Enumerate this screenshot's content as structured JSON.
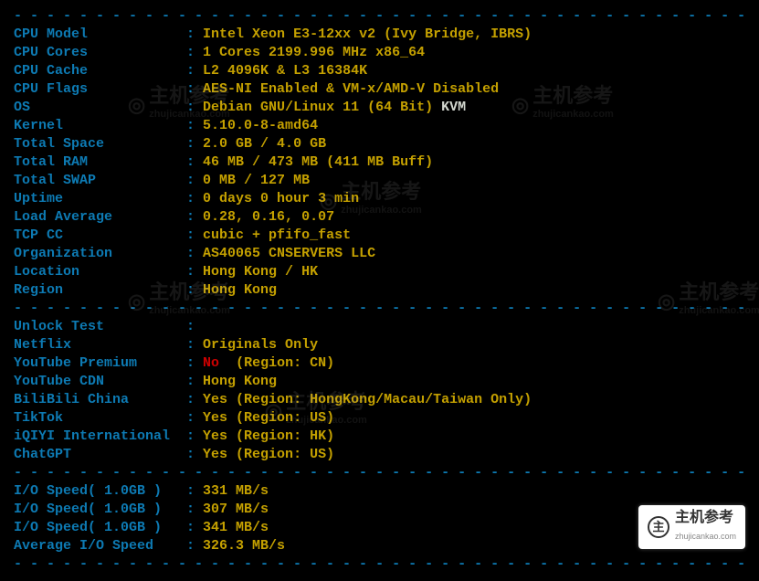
{
  "divider": "- - - - - - - - - - - - - - - - - - - - - - - - - - - - - - - - - - - - - - - - - - - - -",
  "rows": [
    {
      "label": "CPU Model",
      "value": "Intel Xeon E3-12xx v2 (Ivy Bridge, IBRS)"
    },
    {
      "label": "CPU Cores",
      "value": "1 Cores 2199.996 MHz x86_64"
    },
    {
      "label": "CPU Cache",
      "value": "L2 4096K & L3 16384K"
    },
    {
      "label": "CPU Flags",
      "value": "AES-NI Enabled & VM-x/AMD-V Disabled"
    },
    {
      "label": "OS",
      "value": "Debian GNU/Linux 11 (64 Bit)",
      "extra": " KVM",
      "extra_class": "white"
    },
    {
      "label": "Kernel",
      "value": "5.10.0-8-amd64"
    },
    {
      "label": "Total Space",
      "value": "2.0 GB / 4.0 GB"
    },
    {
      "label": "Total RAM",
      "value": "46 MB / 473 MB (411 MB Buff)"
    },
    {
      "label": "Total SWAP",
      "value": "0 MB / 127 MB"
    },
    {
      "label": "Uptime",
      "value": "0 days 0 hour 3 min"
    },
    {
      "label": "Load Average",
      "value": "0.28, 0.16, 0.07"
    },
    {
      "label": "TCP CC",
      "value": "cubic + pfifo_fast"
    },
    {
      "label": "Organization",
      "value": "AS40065 CNSERVERS LLC"
    },
    {
      "label": "Location",
      "value": "Hong Kong / HK"
    },
    {
      "label": "Region",
      "value": "Hong Kong"
    }
  ],
  "unlock_header": {
    "label": "Unlock Test",
    "value": ""
  },
  "unlock": [
    {
      "label": "Netflix",
      "value": "Originals Only"
    },
    {
      "label": "YouTube Premium",
      "value": "No",
      "value_class": "red",
      "extra": "  (Region: CN)"
    },
    {
      "label": "YouTube CDN",
      "value": "Hong Kong"
    },
    {
      "label": "BiliBili China",
      "value": "Yes (Region: HongKong/Macau/Taiwan Only)"
    },
    {
      "label": "TikTok",
      "value": "Yes (Region: US)"
    },
    {
      "label": "iQIYI International",
      "value": "Yes (Region: HK)"
    },
    {
      "label": "ChatGPT",
      "value": "Yes (Region: US)"
    }
  ],
  "io": [
    {
      "label": "I/O Speed( 1.0GB )",
      "value": "331 MB/s"
    },
    {
      "label": "I/O Speed( 1.0GB )",
      "value": "307 MB/s"
    },
    {
      "label": "I/O Speed( 1.0GB )",
      "value": "341 MB/s"
    },
    {
      "label": "Average I/O Speed",
      "value": "326.3 MB/s"
    }
  ],
  "watermark_text": "主机参考",
  "watermark_url": "zhujicankao.com",
  "logo_text": "主机参考",
  "logo_url": "zhujicankao.com"
}
